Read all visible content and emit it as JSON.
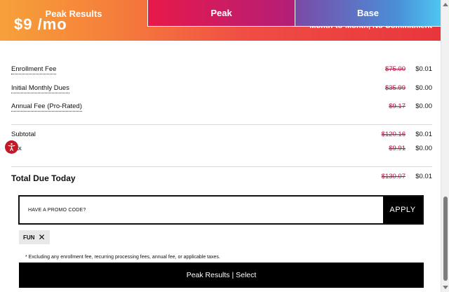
{
  "banner": {
    "price_fragment": "$9 /mo",
    "commitment": "Month-to-Month, No Commitment",
    "gradient_colors": [
      "#f7a13a",
      "#e8353c"
    ]
  },
  "tabs": [
    {
      "label": "Peak Results"
    },
    {
      "label": "Peak"
    },
    {
      "label": "Base"
    }
  ],
  "fees": [
    {
      "label": "Enrollment Fee",
      "was": "$75.00",
      "now": "$0.01"
    },
    {
      "label": "Initial Monthly Dues",
      "was": "$35.99",
      "now": "$0.00"
    },
    {
      "label": "Annual Fee (Pro-Rated)",
      "was": "$9.17",
      "now": "$0.00"
    }
  ],
  "subtotal": {
    "label": "Subtotal",
    "was": "$120.16",
    "now": "$0.01"
  },
  "tax": {
    "label": "Tax",
    "was": "$9.91",
    "now": "$0.00"
  },
  "total": {
    "label": "Total Due Today",
    "was": "$130.07",
    "now": "$0.01"
  },
  "promo": {
    "placeholder": "HAVE A PROMO CODE?",
    "apply_label": "APPLY",
    "applied_code": "FUN"
  },
  "disclaimer": "* Excluding any enrollment fee, recurring processing fees, annual fee, or applicable taxes.",
  "select_button": "Peak Results | Select",
  "colors": {
    "strike": "#b2153f",
    "accessibility": "#c31927"
  }
}
